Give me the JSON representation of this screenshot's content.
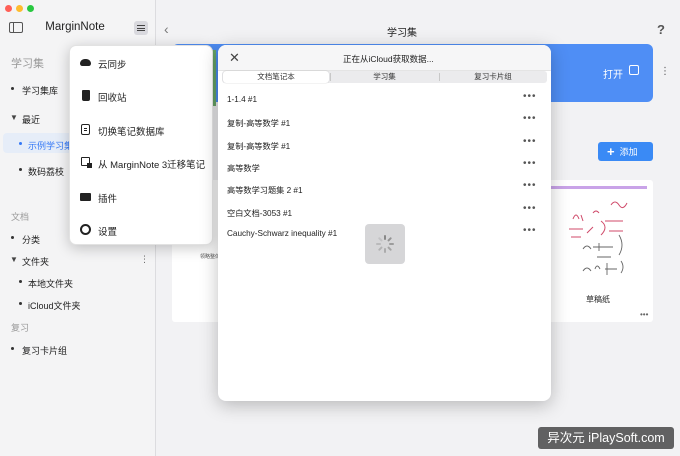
{
  "app": {
    "title": "MarginNote"
  },
  "sidebar": {
    "section_library": "学习集",
    "library_item": "学习集库",
    "recent_header": "最近",
    "recent_items": [
      "示例学习集",
      "数码荔枝"
    ],
    "section_docs": "文档",
    "docs_items": {
      "category": "分类",
      "folders": "文件夹"
    },
    "folder_items": [
      "本地文件夹",
      "iCloud文件夹"
    ],
    "section_review": "复习",
    "review_item": "复习卡片组"
  },
  "main": {
    "title": "学习集",
    "help": "?",
    "open_label": "打开",
    "add_label": "添加",
    "card_caption": "草稿纸",
    "peek_label": "领略整体"
  },
  "menu": {
    "items": [
      {
        "label": "云同步",
        "icon": "cloud-icon"
      },
      {
        "label": "回收站",
        "icon": "trash-icon"
      },
      {
        "label": "切换笔记数据库",
        "icon": "database-icon"
      },
      {
        "label": "从 MarginNote 3迁移笔记",
        "icon": "migrate-icon"
      },
      {
        "label": "插件",
        "icon": "plugin-icon"
      },
      {
        "label": "设置",
        "icon": "gear-icon"
      }
    ]
  },
  "modal": {
    "title": "正在从iCloud获取数据...",
    "close": "✕",
    "tabs": [
      "文档笔记本",
      "学习集",
      "复习卡片组"
    ],
    "selected_tab": 0,
    "notebooks": [
      "1-1.4 #1",
      "复制-高等数学 #1",
      "复制-高等数学 #1",
      "高等数学",
      "高等数学习题集 2 #1",
      "空白文档-3053 #1",
      "Cauchy-Schwarz inequality #1"
    ],
    "more": "•••"
  },
  "watermark": "异次元 iPlaySoft.com",
  "colors": {
    "accent": "#3478f6",
    "banner": "#4f8ef5",
    "add_button": "#3a8af5"
  }
}
